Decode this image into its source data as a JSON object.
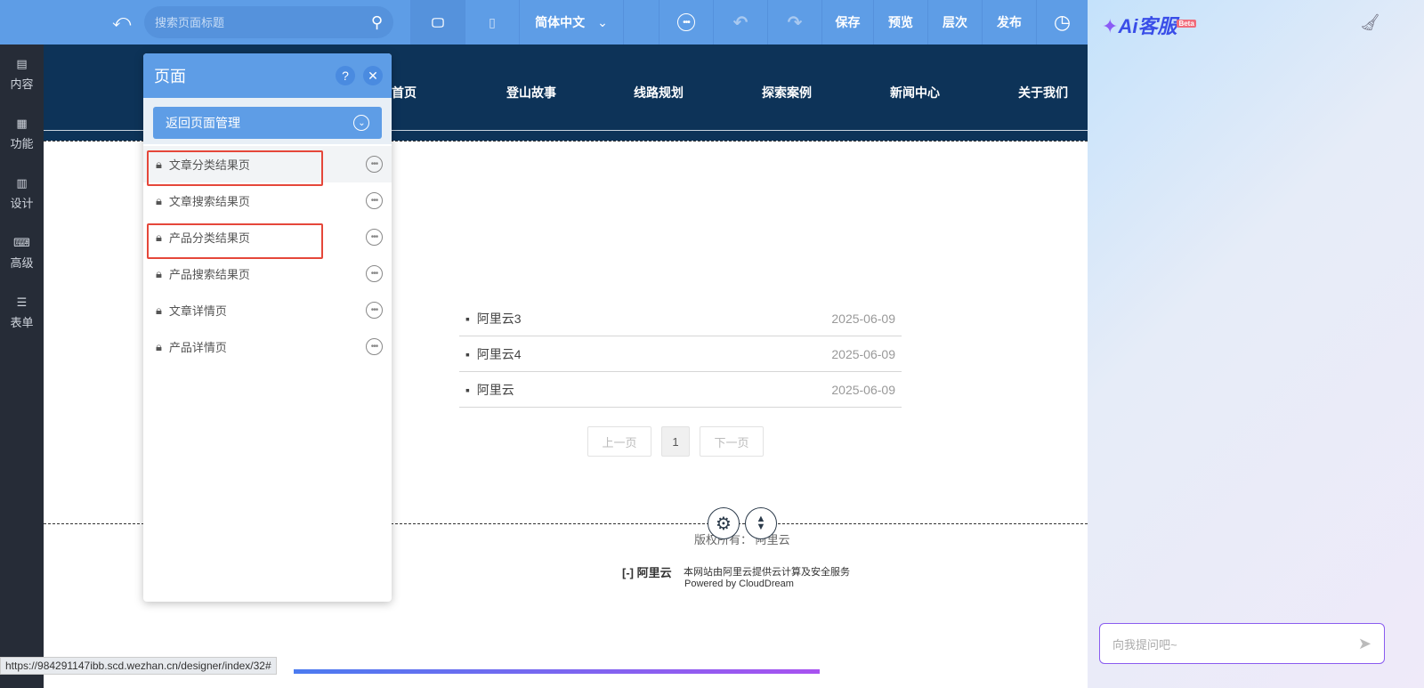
{
  "topbar": {
    "search_placeholder": "搜索页面标题",
    "language": "简体中文",
    "save": "保存",
    "preview": "预览",
    "layers": "层次",
    "publish": "发布"
  },
  "sidebar": [
    {
      "label": "内容",
      "icon": "document-icon"
    },
    {
      "label": "功能",
      "icon": "grid-icon"
    },
    {
      "label": "设计",
      "icon": "layout-icon"
    },
    {
      "label": "高级",
      "icon": "code-icon"
    },
    {
      "label": "表单",
      "icon": "form-icon"
    }
  ],
  "nav": [
    "首页",
    "登山故事",
    "线路规划",
    "探索案例",
    "新闻中心",
    "关于我们"
  ],
  "articles": [
    {
      "title": "阿里云3",
      "date": "2025-06-09"
    },
    {
      "title": "阿里云4",
      "date": "2025-06-09"
    },
    {
      "title": "阿里云",
      "date": "2025-06-09"
    }
  ],
  "pager": {
    "prev": "上一页",
    "current": "1",
    "next": "下一页"
  },
  "footer": {
    "copyright": "版权所有： 阿里云",
    "aliyun_logo": "阿里云",
    "service": "本网站由阿里云提供云计算及安全服务",
    "powered": "Powered by CloudDream"
  },
  "panel": {
    "title": "页面",
    "help": "?",
    "back": "返回页面管理",
    "pages": [
      "文章分类结果页",
      "文章搜索结果页",
      "产品分类结果页",
      "产品搜索结果页",
      "文章详情页",
      "产品详情页"
    ]
  },
  "ai": {
    "brand": "Ai客服",
    "badge": "Beta",
    "placeholder": "向我提问吧~"
  },
  "status_url": "https://984291147ibb.scd.wezhan.cn/designer/index/32#"
}
